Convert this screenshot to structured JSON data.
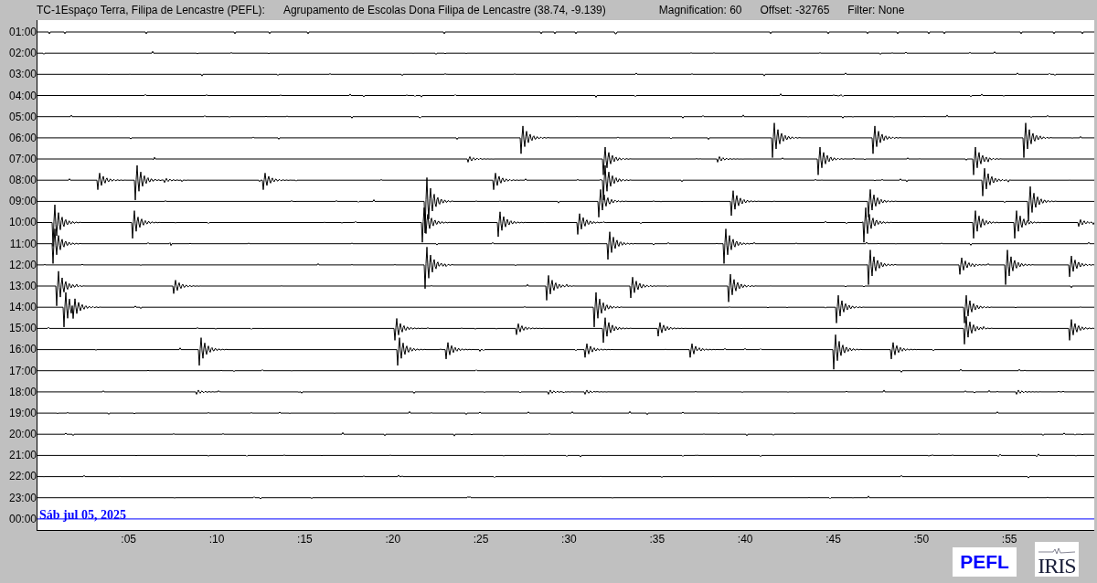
{
  "header": {
    "station": "TC-1Espaço Terra, Filipa de Lencastre (PEFL):",
    "site": "Agrupamento de Escolas Dona Filipa de Lencastre (38.74, -9.139)",
    "magnification": "Magnification: 60",
    "offset": "Offset: -32765",
    "filter": "Filter: None"
  },
  "hour_labels": [
    "01:00",
    "02:00",
    "03:00",
    "04:00",
    "05:00",
    "06:00",
    "07:00",
    "08:00",
    "09:00",
    "10:00",
    "11:00",
    "12:00",
    "13:00",
    "14:00",
    "15:00",
    "16:00",
    "17:00",
    "18:00",
    "19:00",
    "20:00",
    "21:00",
    "22:00",
    "23:00",
    "00:00"
  ],
  "date_label": "Sáb jul 05, 2025",
  "minute_labels": [
    ":05",
    ":10",
    ":15",
    ":20",
    ":25",
    ":30",
    ":35",
    ":40",
    ":45",
    ":50",
    ":55"
  ],
  "logos": {
    "station_logo": "PEFL",
    "network_logo": "IRIS"
  }
}
